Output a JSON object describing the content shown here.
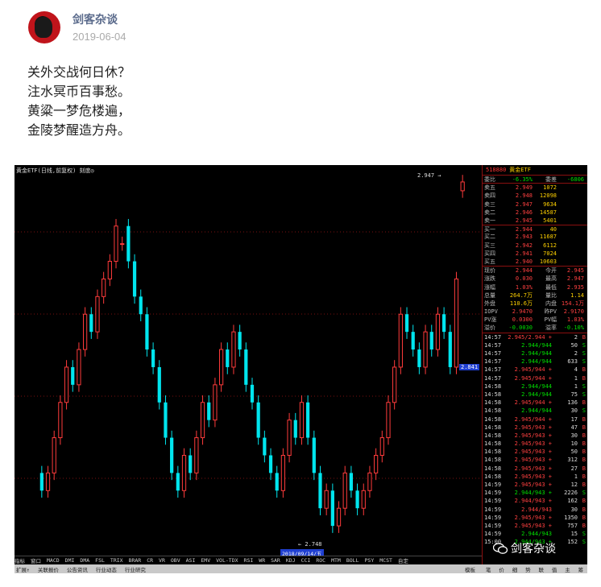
{
  "post": {
    "author": "剑客杂谈",
    "date": "2019-06-04",
    "poem": [
      "关外交战何日休？",
      "注水冥币百事愁。",
      "黄粱一梦危楼遍，",
      "金陵梦醒造方舟。"
    ]
  },
  "chart": {
    "title": "黄金ETF(日线,前复权) 刻度◎",
    "high_label": "2.947",
    "low_label": "2.748",
    "price_tag": "2.841",
    "date_tag": "2018/09/14/五",
    "tabs": [
      "指标",
      "窗口",
      "MACD",
      "DMI",
      "DMA",
      "FSL",
      "TRIX",
      "BRAR",
      "CR",
      "VR",
      "OBV",
      "ASI",
      "EMV",
      "VOL-TDX",
      "RSI",
      "WR",
      "SAR",
      "KDJ",
      "CCI",
      "ROC",
      "MTM",
      "BOLL",
      "PSY",
      "MCST",
      "自定"
    ],
    "bottom_tabs": [
      "扩展↑",
      "关联报价",
      "公告资讯",
      "行业动态",
      "行业研究"
    ],
    "tab_right": "模板"
  },
  "chart_data": {
    "type": "candlestick",
    "open": [
      2.78,
      2.77,
      2.78,
      2.8,
      2.82,
      2.84,
      2.83,
      2.85,
      2.87,
      2.86,
      2.88,
      2.89,
      2.9,
      2.91,
      2.92,
      2.9,
      2.88,
      2.87,
      2.85,
      2.84,
      2.82,
      2.8,
      2.78,
      2.77,
      2.79,
      2.78,
      2.8,
      2.82,
      2.81,
      2.83,
      2.85,
      2.84,
      2.86,
      2.85,
      2.83,
      2.82,
      2.8,
      2.79,
      2.78,
      2.77,
      2.79,
      2.81,
      2.8,
      2.82,
      2.8,
      2.78,
      2.76,
      2.77,
      2.75,
      2.76,
      2.78,
      2.77,
      2.76,
      2.77,
      2.78,
      2.79,
      2.8,
      2.82,
      2.84,
      2.87,
      2.86,
      2.85,
      2.84,
      2.86,
      2.85,
      2.87,
      2.86,
      2.84,
      2.94
    ],
    "close": [
      2.77,
      2.78,
      2.8,
      2.82,
      2.84,
      2.83,
      2.85,
      2.87,
      2.86,
      2.88,
      2.89,
      2.9,
      2.92,
      2.91,
      2.9,
      2.88,
      2.87,
      2.85,
      2.84,
      2.82,
      2.8,
      2.78,
      2.77,
      2.79,
      2.78,
      2.8,
      2.82,
      2.81,
      2.83,
      2.85,
      2.84,
      2.86,
      2.85,
      2.83,
      2.82,
      2.8,
      2.79,
      2.78,
      2.77,
      2.79,
      2.81,
      2.8,
      2.82,
      2.8,
      2.78,
      2.76,
      2.77,
      2.75,
      2.76,
      2.78,
      2.77,
      2.76,
      2.77,
      2.78,
      2.79,
      2.8,
      2.82,
      2.84,
      2.87,
      2.86,
      2.85,
      2.84,
      2.86,
      2.85,
      2.87,
      2.86,
      2.84,
      2.89,
      2.945
    ],
    "high_label_value": 2.947,
    "low_label_value": 2.748,
    "ylim": [
      2.74,
      2.95
    ]
  },
  "quote": {
    "code": "518880",
    "name": "黄金ETF",
    "header_row": [
      "委比",
      "-6.35%",
      "委差",
      "-6806"
    ],
    "book": [
      [
        "卖五",
        "2.949",
        "1072"
      ],
      [
        "卖四",
        "2.948",
        "12098"
      ],
      [
        "卖三",
        "2.947",
        "9634"
      ],
      [
        "卖二",
        "2.946",
        "14587"
      ],
      [
        "卖一",
        "2.945",
        "5401"
      ],
      [
        "买一",
        "2.944",
        "40"
      ],
      [
        "买二",
        "2.943",
        "11687"
      ],
      [
        "买三",
        "2.942",
        "6112"
      ],
      [
        "买四",
        "2.941",
        "7024"
      ],
      [
        "买五",
        "2.940",
        "10603"
      ]
    ],
    "stats": [
      [
        "现价",
        "2.944",
        "今开",
        "2.945"
      ],
      [
        "涨跌",
        "0.030",
        "最高",
        "2.947"
      ],
      [
        "涨幅",
        "1.03%",
        "最低",
        "2.935"
      ],
      [
        "总量",
        "264.7万",
        "量比",
        "1.14"
      ],
      [
        "外盘",
        "110.6万",
        "内盘",
        "154.1万"
      ],
      [
        "IOPV",
        "2.9470",
        "昨PV",
        "2.9170"
      ],
      [
        "PV涨",
        "0.0300",
        "PV幅",
        "1.03%"
      ],
      [
        "溢价",
        "-0.0030",
        "溢率",
        "-0.10%"
      ]
    ],
    "ticks": [
      [
        "14:57",
        "2.945/2.944 +",
        "2",
        "B"
      ],
      [
        "14:57",
        "2.944/944",
        "50",
        "S"
      ],
      [
        "14:57",
        "2.944/944",
        "2",
        "S"
      ],
      [
        "14:57",
        "2.944/944",
        "633",
        "S"
      ],
      [
        "14:57",
        "2.945/944 +",
        "4",
        "B"
      ],
      [
        "14:57",
        "2.945/944 +",
        "1",
        "B"
      ],
      [
        "14:58",
        "2.944/944",
        "1",
        "S"
      ],
      [
        "14:58",
        "2.944/944",
        "75",
        "S"
      ],
      [
        "14:58",
        "2.945/944 +",
        "136",
        "B"
      ],
      [
        "14:58",
        "2.944/944",
        "30",
        "S"
      ],
      [
        "14:58",
        "2.945/944 +",
        "17",
        "B"
      ],
      [
        "14:58",
        "2.945/943 +",
        "47",
        "B"
      ],
      [
        "14:58",
        "2.945/943 +",
        "30",
        "B"
      ],
      [
        "14:58",
        "2.945/943 +",
        "10",
        "B"
      ],
      [
        "14:58",
        "2.945/943 +",
        "50",
        "B"
      ],
      [
        "14:58",
        "2.945/943 +",
        "312",
        "B"
      ],
      [
        "14:58",
        "2.945/943 +",
        "27",
        "B"
      ],
      [
        "14:58",
        "2.945/943 +",
        "1",
        "B"
      ],
      [
        "14:59",
        "2.945/943 +",
        "12",
        "B"
      ],
      [
        "14:59",
        "2.944/943 +",
        "2226",
        "S"
      ],
      [
        "14:59",
        "2.944/943 +",
        "162",
        "B"
      ],
      [
        "14:59",
        "2.944/943",
        "30",
        "B"
      ],
      [
        "14:59",
        "2.945/943 +",
        "1350",
        "B"
      ],
      [
        "14:59",
        "2.945/943 +",
        "757",
        "B"
      ],
      [
        "14:59",
        "2.944/943",
        "15",
        "S"
      ],
      [
        "15:00",
        "2.944/943 +",
        "152",
        "S"
      ]
    ],
    "foot_tabs": [
      "笔",
      "价",
      "细",
      "势",
      "联",
      "值",
      "主",
      "筹"
    ]
  },
  "watermark": "剑客杂谈",
  "colors": {
    "up": "#ff3b3b",
    "down": "#00e5ee",
    "yellow": "#ffd100",
    "red_text": "#ff4040",
    "green_text": "#00e000"
  }
}
